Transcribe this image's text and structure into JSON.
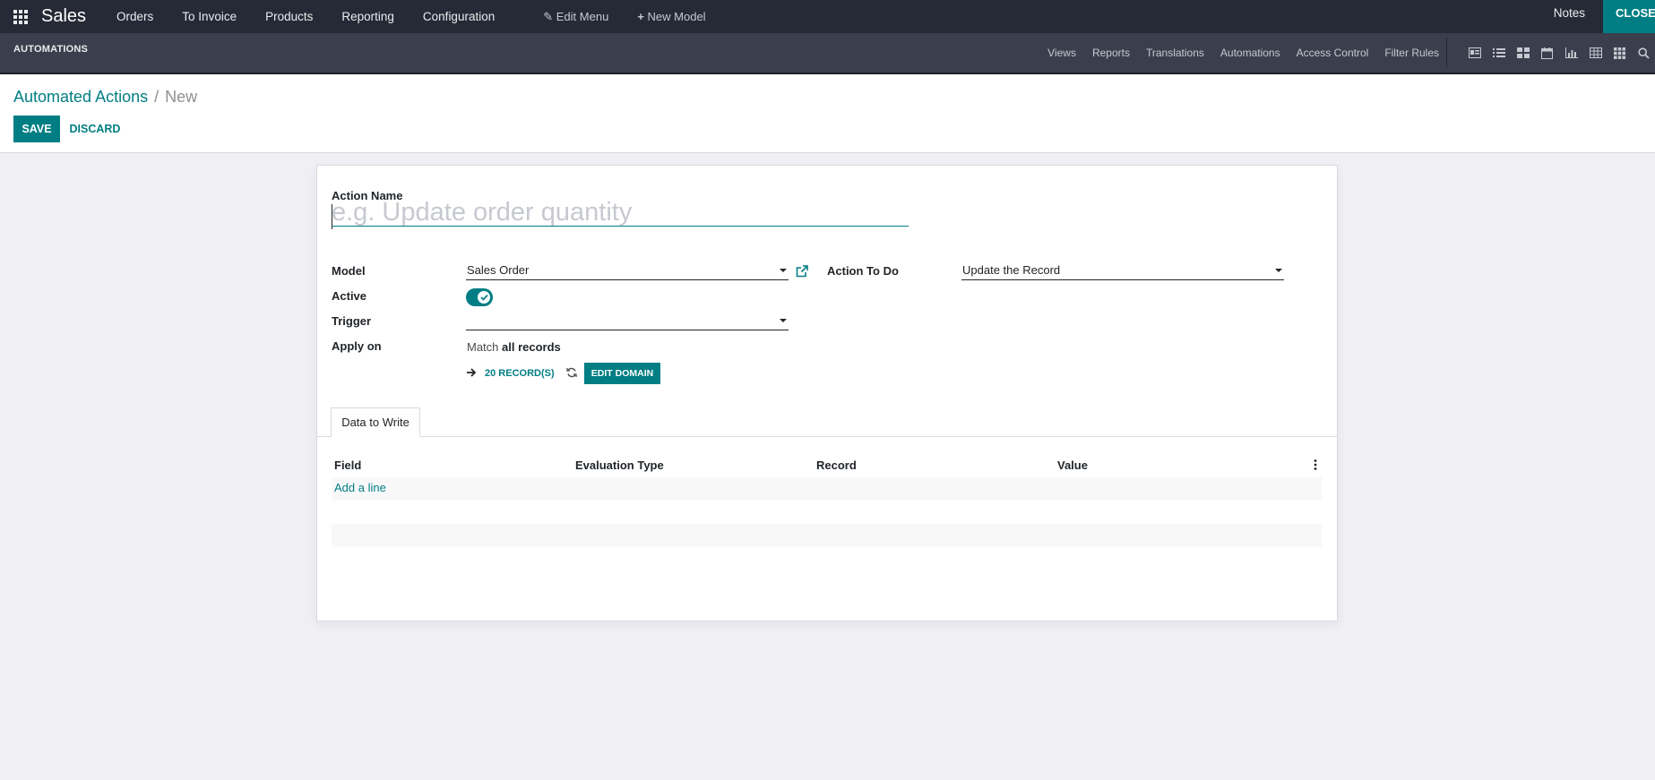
{
  "topbar": {
    "brand": "Sales",
    "menu": [
      "Orders",
      "To Invoice",
      "Products",
      "Reporting",
      "Configuration"
    ],
    "edit_menu": "Edit Menu",
    "new_model": "New Model",
    "notes": "Notes",
    "close": "CLOSE"
  },
  "subbar": {
    "title": "AUTOMATIONS",
    "links": [
      "Views",
      "Reports",
      "Translations",
      "Automations",
      "Access Control",
      "Filter Rules"
    ],
    "view_icons": [
      "form-view-icon",
      "list-view-icon",
      "kanban-view-icon",
      "calendar-view-icon",
      "graph-view-icon",
      "pivot-view-icon",
      "grid-view-icon",
      "search-icon"
    ]
  },
  "controlpanel": {
    "breadcrumb_parent": "Automated Actions",
    "breadcrumb_current": "New",
    "save_label": "SAVE",
    "discard_label": "DISCARD"
  },
  "form": {
    "action_name_label": "Action Name",
    "action_name_placeholder": "e.g. Update order quantity",
    "model_label": "Model",
    "model_value": "Sales Order",
    "action_to_do_label": "Action To Do",
    "action_to_do_value": "Update the Record",
    "active_label": "Active",
    "active": true,
    "trigger_label": "Trigger",
    "trigger_value": "",
    "apply_on_label": "Apply on",
    "match_text": "Match",
    "match_value": "all records",
    "records_count": "20 RECORD(S)",
    "edit_domain": "EDIT DOMAIN"
  },
  "tabs": [
    "Data to Write"
  ],
  "table": {
    "columns": [
      "Field",
      "Evaluation Type",
      "Record",
      "Value"
    ],
    "add_line": "Add a line"
  },
  "colors": {
    "primary": "#017e84",
    "navbar": "#262a36",
    "subbar": "#3b3f4d"
  }
}
